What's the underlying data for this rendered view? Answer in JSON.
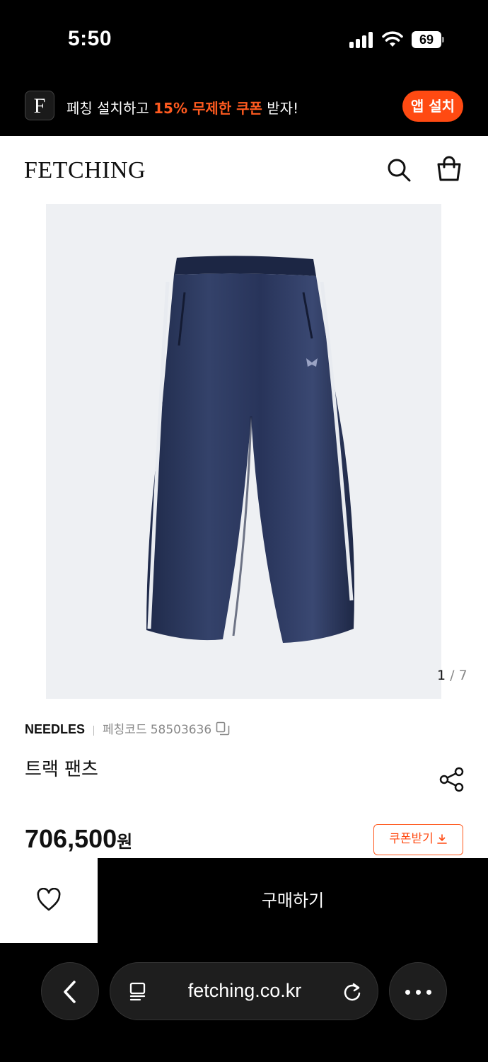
{
  "status_bar": {
    "time": "5:50",
    "battery": "69"
  },
  "app_banner": {
    "logo_letter": "F",
    "text_before": "페칭 설치하고 ",
    "text_highlight": "15% 무제한 쿠폰",
    "text_after": " 받자!",
    "install_label": "앱 설치",
    "accent_color": "#ff4a12"
  },
  "header": {
    "logo": "FETCHING"
  },
  "gallery": {
    "current": "1",
    "total": "/ 7"
  },
  "product": {
    "brand": "NEEDLES",
    "code_label": "페칭코드",
    "code_value": "58503636",
    "name": "트랙 팬츠",
    "price": "706,500",
    "currency": "원",
    "coupon_label": "쿠폰받기"
  },
  "actions": {
    "buy_label": "구매하기"
  },
  "browser": {
    "url": "fetching.co.kr"
  },
  "icons": {
    "search": "search-icon",
    "bag": "shopping-bag-icon",
    "copy": "copy-icon",
    "share": "share-icon",
    "download": "download-icon",
    "wishlist": "heart-icon",
    "back": "chevron-left-icon",
    "reader": "reader-icon",
    "reload": "reload-icon",
    "more": "more-icon"
  }
}
